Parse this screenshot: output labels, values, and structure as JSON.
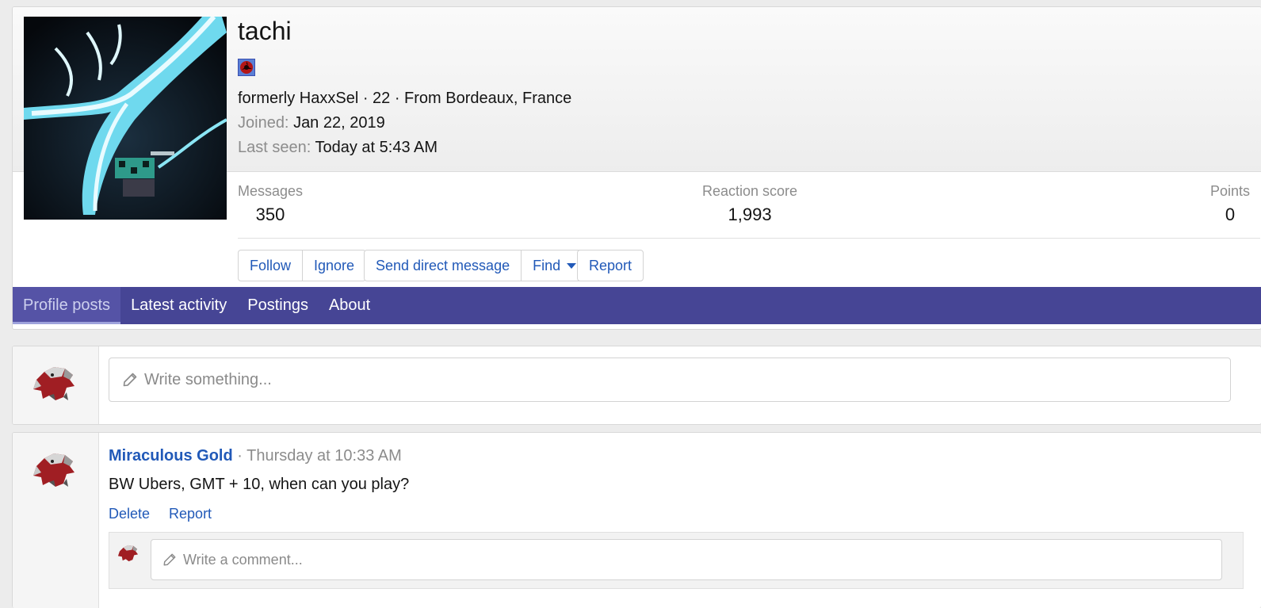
{
  "profile": {
    "username": "tachi",
    "subtitle": "formerly HaxxSel · 22 · From Bordeaux, France",
    "joined_label": "Joined:",
    "joined_value": "Jan 22, 2019",
    "last_seen_label": "Last seen:",
    "last_seen_value": "Today at 5:43 AM",
    "stats": [
      {
        "label": "Messages",
        "value": "350"
      },
      {
        "label": "Reaction score",
        "value": "1,993"
      },
      {
        "label": "Points",
        "value": "0"
      }
    ],
    "buttons": {
      "follow": "Follow",
      "ignore": "Ignore",
      "send_dm": "Send direct message",
      "find": "Find",
      "report": "Report"
    }
  },
  "tabs": [
    {
      "label": "Profile posts",
      "active": true
    },
    {
      "label": "Latest activity",
      "active": false
    },
    {
      "label": "Postings",
      "active": false
    },
    {
      "label": "About",
      "active": false
    }
  ],
  "composer": {
    "placeholder": "Write something..."
  },
  "post": {
    "author": "Miraculous Gold",
    "separator": " · ",
    "time": "Thursday at 10:33 AM",
    "body": "BW Ubers, GMT + 10, when can you play?",
    "actions": {
      "delete": "Delete",
      "report": "Report"
    },
    "comment_placeholder": "Write a comment..."
  },
  "colors": {
    "nav_bar": "#464595",
    "link": "#2159b8",
    "muted": "#8c8c8c"
  },
  "icons": [
    "pencil-icon",
    "chevron-down-icon",
    "user-banner-icon"
  ]
}
